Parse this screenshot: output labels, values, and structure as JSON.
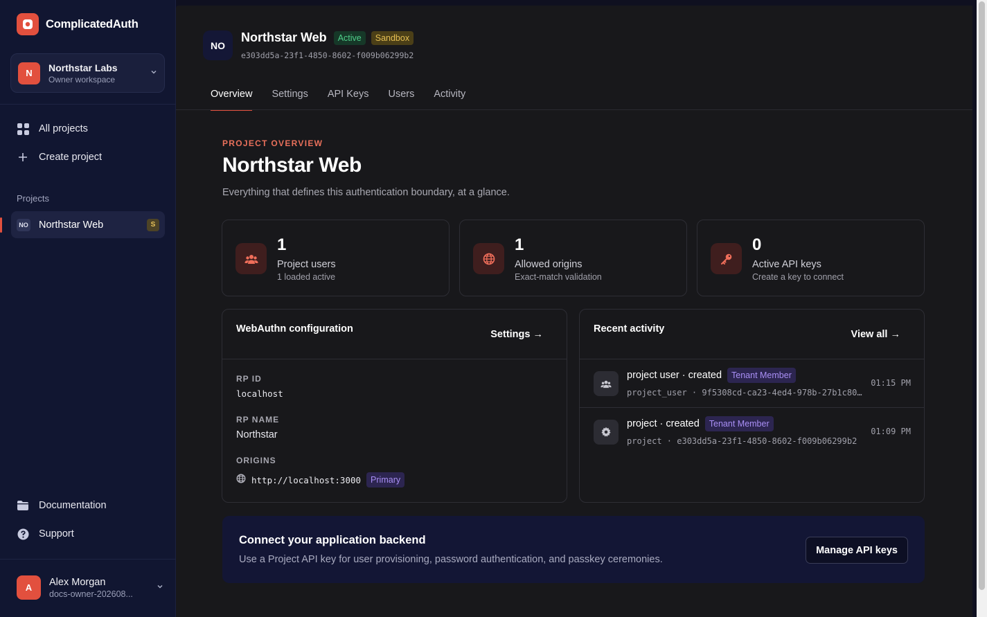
{
  "app": {
    "name": "ComplicatedAuth",
    "brand_color": "#e2503e"
  },
  "workspace": {
    "initial": "N",
    "name": "Northstar Labs",
    "subtitle": "Owner workspace"
  },
  "nav": {
    "all_projects": "All projects",
    "create_project": "Create project",
    "projects_heading": "Projects",
    "documentation": "Documentation",
    "support": "Support"
  },
  "project_list": [
    {
      "chip": "NO",
      "name": "Northstar Web",
      "badge": "S"
    }
  ],
  "user": {
    "initial": "A",
    "name": "Alex Morgan",
    "subtitle": "docs-owner-202608..."
  },
  "project": {
    "initials": "NO",
    "name": "Northstar Web",
    "status": "Active",
    "environment": "Sandbox",
    "id": "e303dd5a-23f1-4850-8602-f009b06299b2"
  },
  "tabs": [
    "Overview",
    "Settings",
    "API Keys",
    "Users",
    "Activity"
  ],
  "active_tab": "Overview",
  "overview": {
    "eyebrow": "PROJECT OVERVIEW",
    "title": "Northstar Web",
    "subtitle": "Everything that defines this authentication boundary, at a glance."
  },
  "stats": [
    {
      "icon": "users-icon",
      "value": "1",
      "label": "Project users",
      "sub": "1 loaded active"
    },
    {
      "icon": "globe-icon",
      "value": "1",
      "label": "Allowed origins",
      "sub": "Exact-match validation"
    },
    {
      "icon": "key-icon",
      "value": "0",
      "label": "Active API keys",
      "sub": "Create a key to connect"
    }
  ],
  "webauthn": {
    "title": "WebAuthn configuration",
    "link": "Settings →",
    "rp_id_label": "RP ID",
    "rp_id": "localhost",
    "rp_name_label": "RP NAME",
    "rp_name": "Northstar",
    "origins_label": "ORIGINS",
    "origin": "http://localhost:3000",
    "origin_badge": "Primary"
  },
  "activity": {
    "title": "Recent activity",
    "link": "View all →",
    "items": [
      {
        "icon": "users-icon",
        "title": "project user · created",
        "badge": "Tenant Member",
        "detail": "project_user · 9f5308cd-ca23-4ed4-978b-27b1c80…",
        "time": "01:15 PM"
      },
      {
        "icon": "gear-icon",
        "title": "project · created",
        "badge": "Tenant Member",
        "detail": "project · e303dd5a-23f1-4850-8602-f009b06299b2",
        "time": "01:09 PM"
      }
    ]
  },
  "cta": {
    "title": "Connect your application backend",
    "subtitle": "Use a Project API key for user provisioning, password authentication, and passkey ceremonies.",
    "button": "Manage API keys"
  }
}
